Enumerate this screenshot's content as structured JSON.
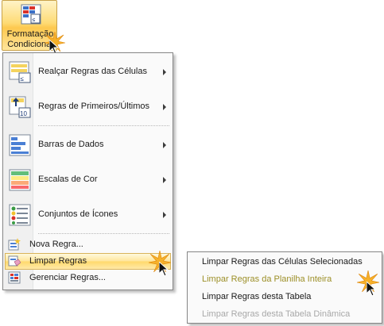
{
  "ribbon": {
    "button": {
      "line1": "Formatação",
      "line2": "Condicional",
      "icon": "conditional-formatting-icon"
    }
  },
  "menu": {
    "big_items": [
      {
        "label": "Realçar Regras das Células",
        "icon": "highlight-cell-rules-icon",
        "has_submenu": true
      },
      {
        "label": "Regras de Primeiros/Últimos",
        "icon": "top-bottom-rules-icon",
        "has_submenu": true
      },
      {
        "label": "Barras de Dados",
        "icon": "data-bars-icon",
        "has_submenu": true
      },
      {
        "label": "Escalas de Cor",
        "icon": "color-scales-icon",
        "has_submenu": true
      },
      {
        "label": "Conjuntos de Ícones",
        "icon": "icon-sets-icon",
        "has_submenu": true
      }
    ],
    "small_items": [
      {
        "label": "Nova Regra...",
        "icon": "new-rule-icon"
      },
      {
        "label": "Limpar Regras",
        "icon": "clear-rules-icon",
        "highlighted": true,
        "has_submenu": true
      },
      {
        "label": "Gerenciar Regras...",
        "icon": "manage-rules-icon"
      }
    ]
  },
  "submenu": {
    "items": [
      {
        "label": "Limpar Regras das Células Selecionadas"
      },
      {
        "label": "Limpar Regras da Planilha Inteira",
        "highlighted": true
      },
      {
        "label": "Limpar Regras desta Tabela"
      },
      {
        "label": "Limpar Regras desta Tabela Dinâmica",
        "disabled": true
      }
    ]
  },
  "colors": {
    "highlight_gradient_top": "#fff9dc",
    "highlight_gradient_bottom": "#ffd96b",
    "highlight_text": "#9c8f27",
    "disabled_text": "#a8a8a8",
    "burst": "#f5a623"
  }
}
